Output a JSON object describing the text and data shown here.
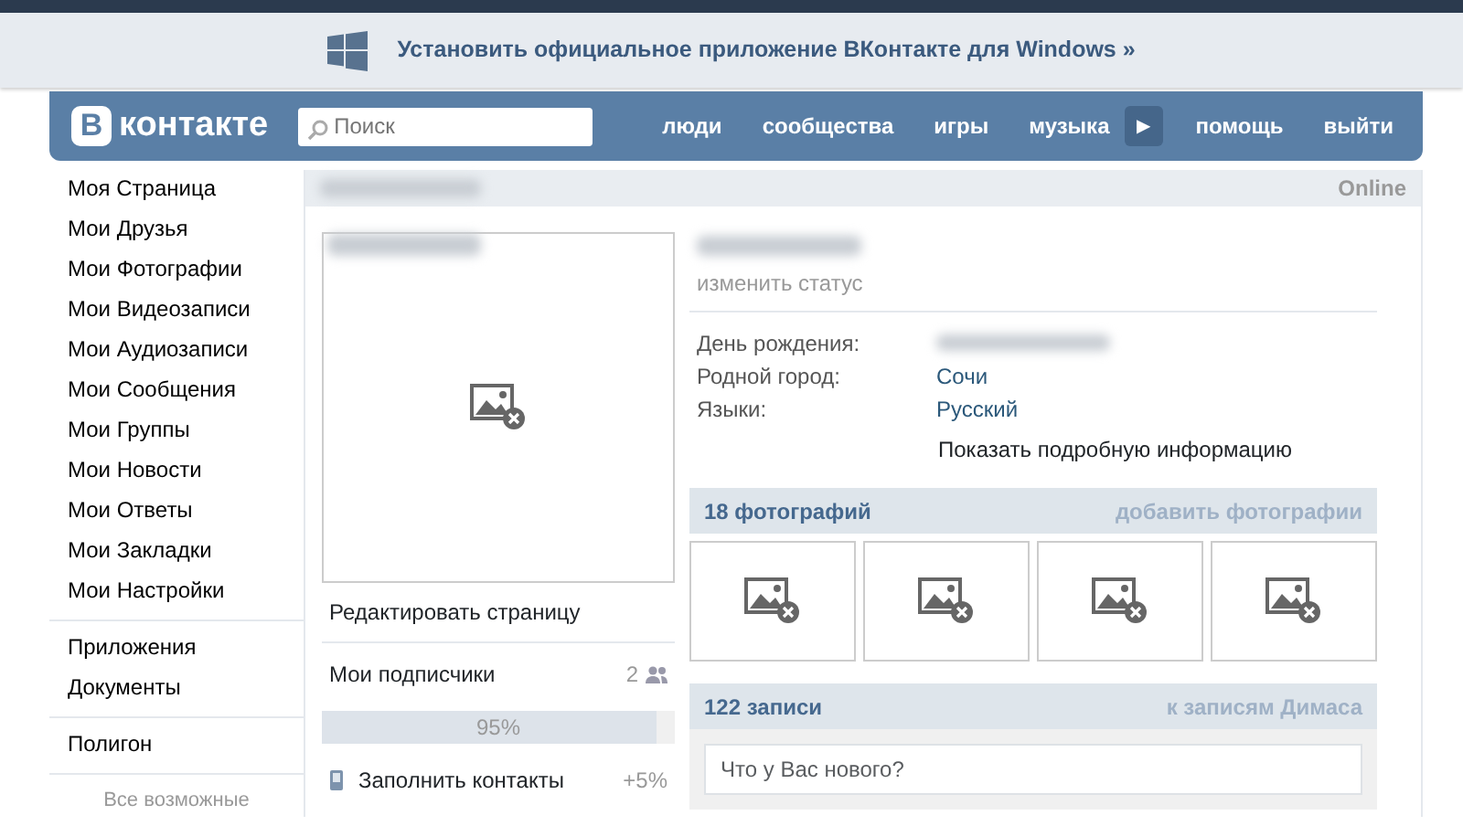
{
  "banner": {
    "text": "Установить официальное приложение ВКонтакте для Windows »"
  },
  "header": {
    "logo_letter": "В",
    "logo_text": "контакте",
    "search": {
      "placeholder": "Поиск"
    },
    "nav": [
      "люди",
      "сообщества",
      "игры",
      "музыка"
    ],
    "play_button": "▶",
    "nav_right": [
      "помощь",
      "выйти"
    ]
  },
  "sidebar": {
    "groups": [
      [
        "Моя Страница",
        "Мои Друзья",
        "Мои Фотографии",
        "Мои Видеозаписи",
        "Мои Аудиозаписи",
        "Мои Сообщения",
        "Мои Группы",
        "Мои Новости",
        "Мои Ответы",
        "Мои Закладки",
        "Мои Настройки"
      ],
      [
        "Приложения",
        "Документы"
      ],
      [
        "Полигон"
      ]
    ],
    "footer": "Все возможные"
  },
  "profile": {
    "name_redacted": true,
    "online": "Online",
    "avatar": {
      "redacted_caption": true
    },
    "actions": [
      {
        "kind": "link",
        "label": "Редактировать страницу"
      },
      {
        "kind": "count",
        "label": "Мои подписчики",
        "count": "2"
      }
    ],
    "completion": {
      "level": 0.95,
      "label": "95%"
    },
    "tip": {
      "label": "Заполнить контакты",
      "bonus": "+5%"
    },
    "full_name_redacted": true,
    "status": "изменить статус",
    "info": [
      {
        "label": "День рождения:",
        "redacted": true
      },
      {
        "label": "Родной город:",
        "value": "Сочи",
        "redacted": false
      },
      {
        "label": "Языки:",
        "value": "Русский",
        "redacted": false
      }
    ],
    "more": "Показать подробную информацию",
    "photos": {
      "title": "18 фотографий",
      "action": "добавить фотографии"
    },
    "wall": {
      "title": "122 записи",
      "action": "к записям Димаса",
      "placeholder": "Что у Вас нового?"
    }
  }
}
